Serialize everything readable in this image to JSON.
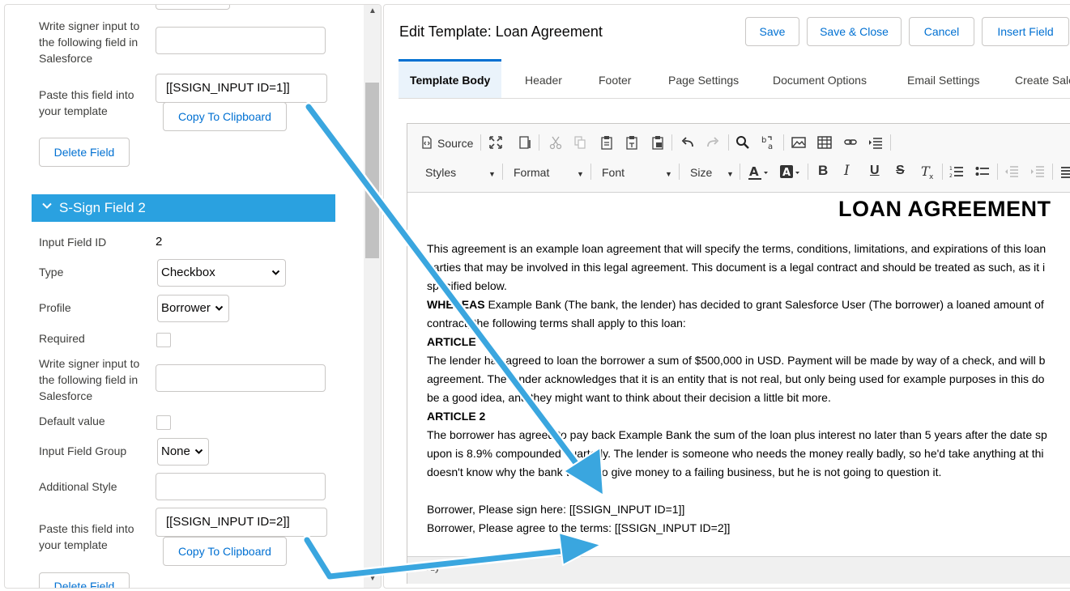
{
  "left": {
    "field1": {
      "write_label": "Write signer input to the following field in Salesforce",
      "paste_label": "Paste this field into your template",
      "code": "[[SSIGN_INPUT ID=1]]",
      "copy_label": "Copy To Clipboard",
      "delete_label": "Delete Field"
    },
    "field2": {
      "section_title": "S-Sign Field 2",
      "input_id_label": "Input Field ID",
      "input_id_value": "2",
      "type_label": "Type",
      "type_value": "Checkbox",
      "profile_label": "Profile",
      "profile_value": "Borrower",
      "required_label": "Required",
      "write_label": "Write signer input to the following field in Salesforce",
      "default_label": "Default value",
      "group_label": "Input Field Group",
      "group_value": "None",
      "style_label": "Additional Style",
      "paste_label": "Paste this field into your template",
      "code": "[[SSIGN_INPUT ID=2]]",
      "copy_label": "Copy To Clipboard",
      "delete_label": "Delete Field"
    }
  },
  "header": {
    "title": "Edit Template: Loan Agreement",
    "buttons": {
      "save": "Save",
      "save_close": "Save & Close",
      "cancel": "Cancel",
      "insert_field": "Insert Field"
    }
  },
  "tabs": [
    "Template Body",
    "Header",
    "Footer",
    "Page Settings",
    "Document Options",
    "Email Settings",
    "Create Sale"
  ],
  "toolbar": {
    "source": "Source",
    "styles": "Styles",
    "format": "Format",
    "font": "Font",
    "size": "Size",
    "icons": [
      "maximize-icon",
      "preview-icon",
      "cut-icon",
      "copy-icon",
      "paste-icon",
      "paste-text-icon",
      "paste-word-icon",
      "undo-icon",
      "redo-icon",
      "find-icon",
      "replace-icon",
      "image-icon",
      "table-icon",
      "link-icon",
      "indent-icon",
      "text-color-icon",
      "bg-color-icon",
      "bold-icon",
      "italic-icon",
      "underline-icon",
      "strike-icon",
      "remove-format-icon",
      "numbered-list-icon",
      "bulleted-list-icon",
      "outdent-icon",
      "indent-block-icon",
      "align-icon"
    ]
  },
  "document": {
    "title": "LOAN AGREEMENT",
    "line1": "This agreement is an example loan agreement that will specify the terms, conditions, limitations, and expirations of this loan",
    "line2": "parties that may be involved in this legal agreement. This document is a legal contract and should be treated as such, as it i",
    "line3": "specified below.",
    "whereas_bold": "WHEREAS",
    "whereas_text": " Example Bank (The bank, the lender) has decided to grant Salesforce User (The borrower) a loaned amount of",
    "line5": "contract, the following terms shall apply to this loan:",
    "article1": "ARTICLE",
    "line7": "The lender has agreed to loan the borrower a sum of $500,000 in USD. Payment will be made by way of a check, and will b",
    "line8": "agreement. The lender acknowledges that it is an entity that is not real, but only being used for example purposes in this do",
    "line9": "be a good idea, and they might want to think about their decision a little bit more.",
    "article2": "ARTICLE 2",
    "line11": "The borrower has agreed to pay back Example Bank the sum of the loan plus interest no later than 5 years after the date sp",
    "line12": "upon is 8.9% compounded quarterly. The lender is someone who needs the money really badly, so he'd take anything at thi",
    "line13": "doesn't know why the bank wants to give money to a failing business, but he is not going to question it.",
    "sign_line": "Borrower, Please sign here: [[SSIGN_INPUT ID=1]]",
    "agree_line": "Borrower, Please agree to the terms: [[SSIGN_INPUT ID=2]]"
  },
  "status_bar": "body",
  "colors": {
    "accent": "#0070d2",
    "section_header": "#2aa1e0",
    "arrow": "#3aa6df"
  }
}
